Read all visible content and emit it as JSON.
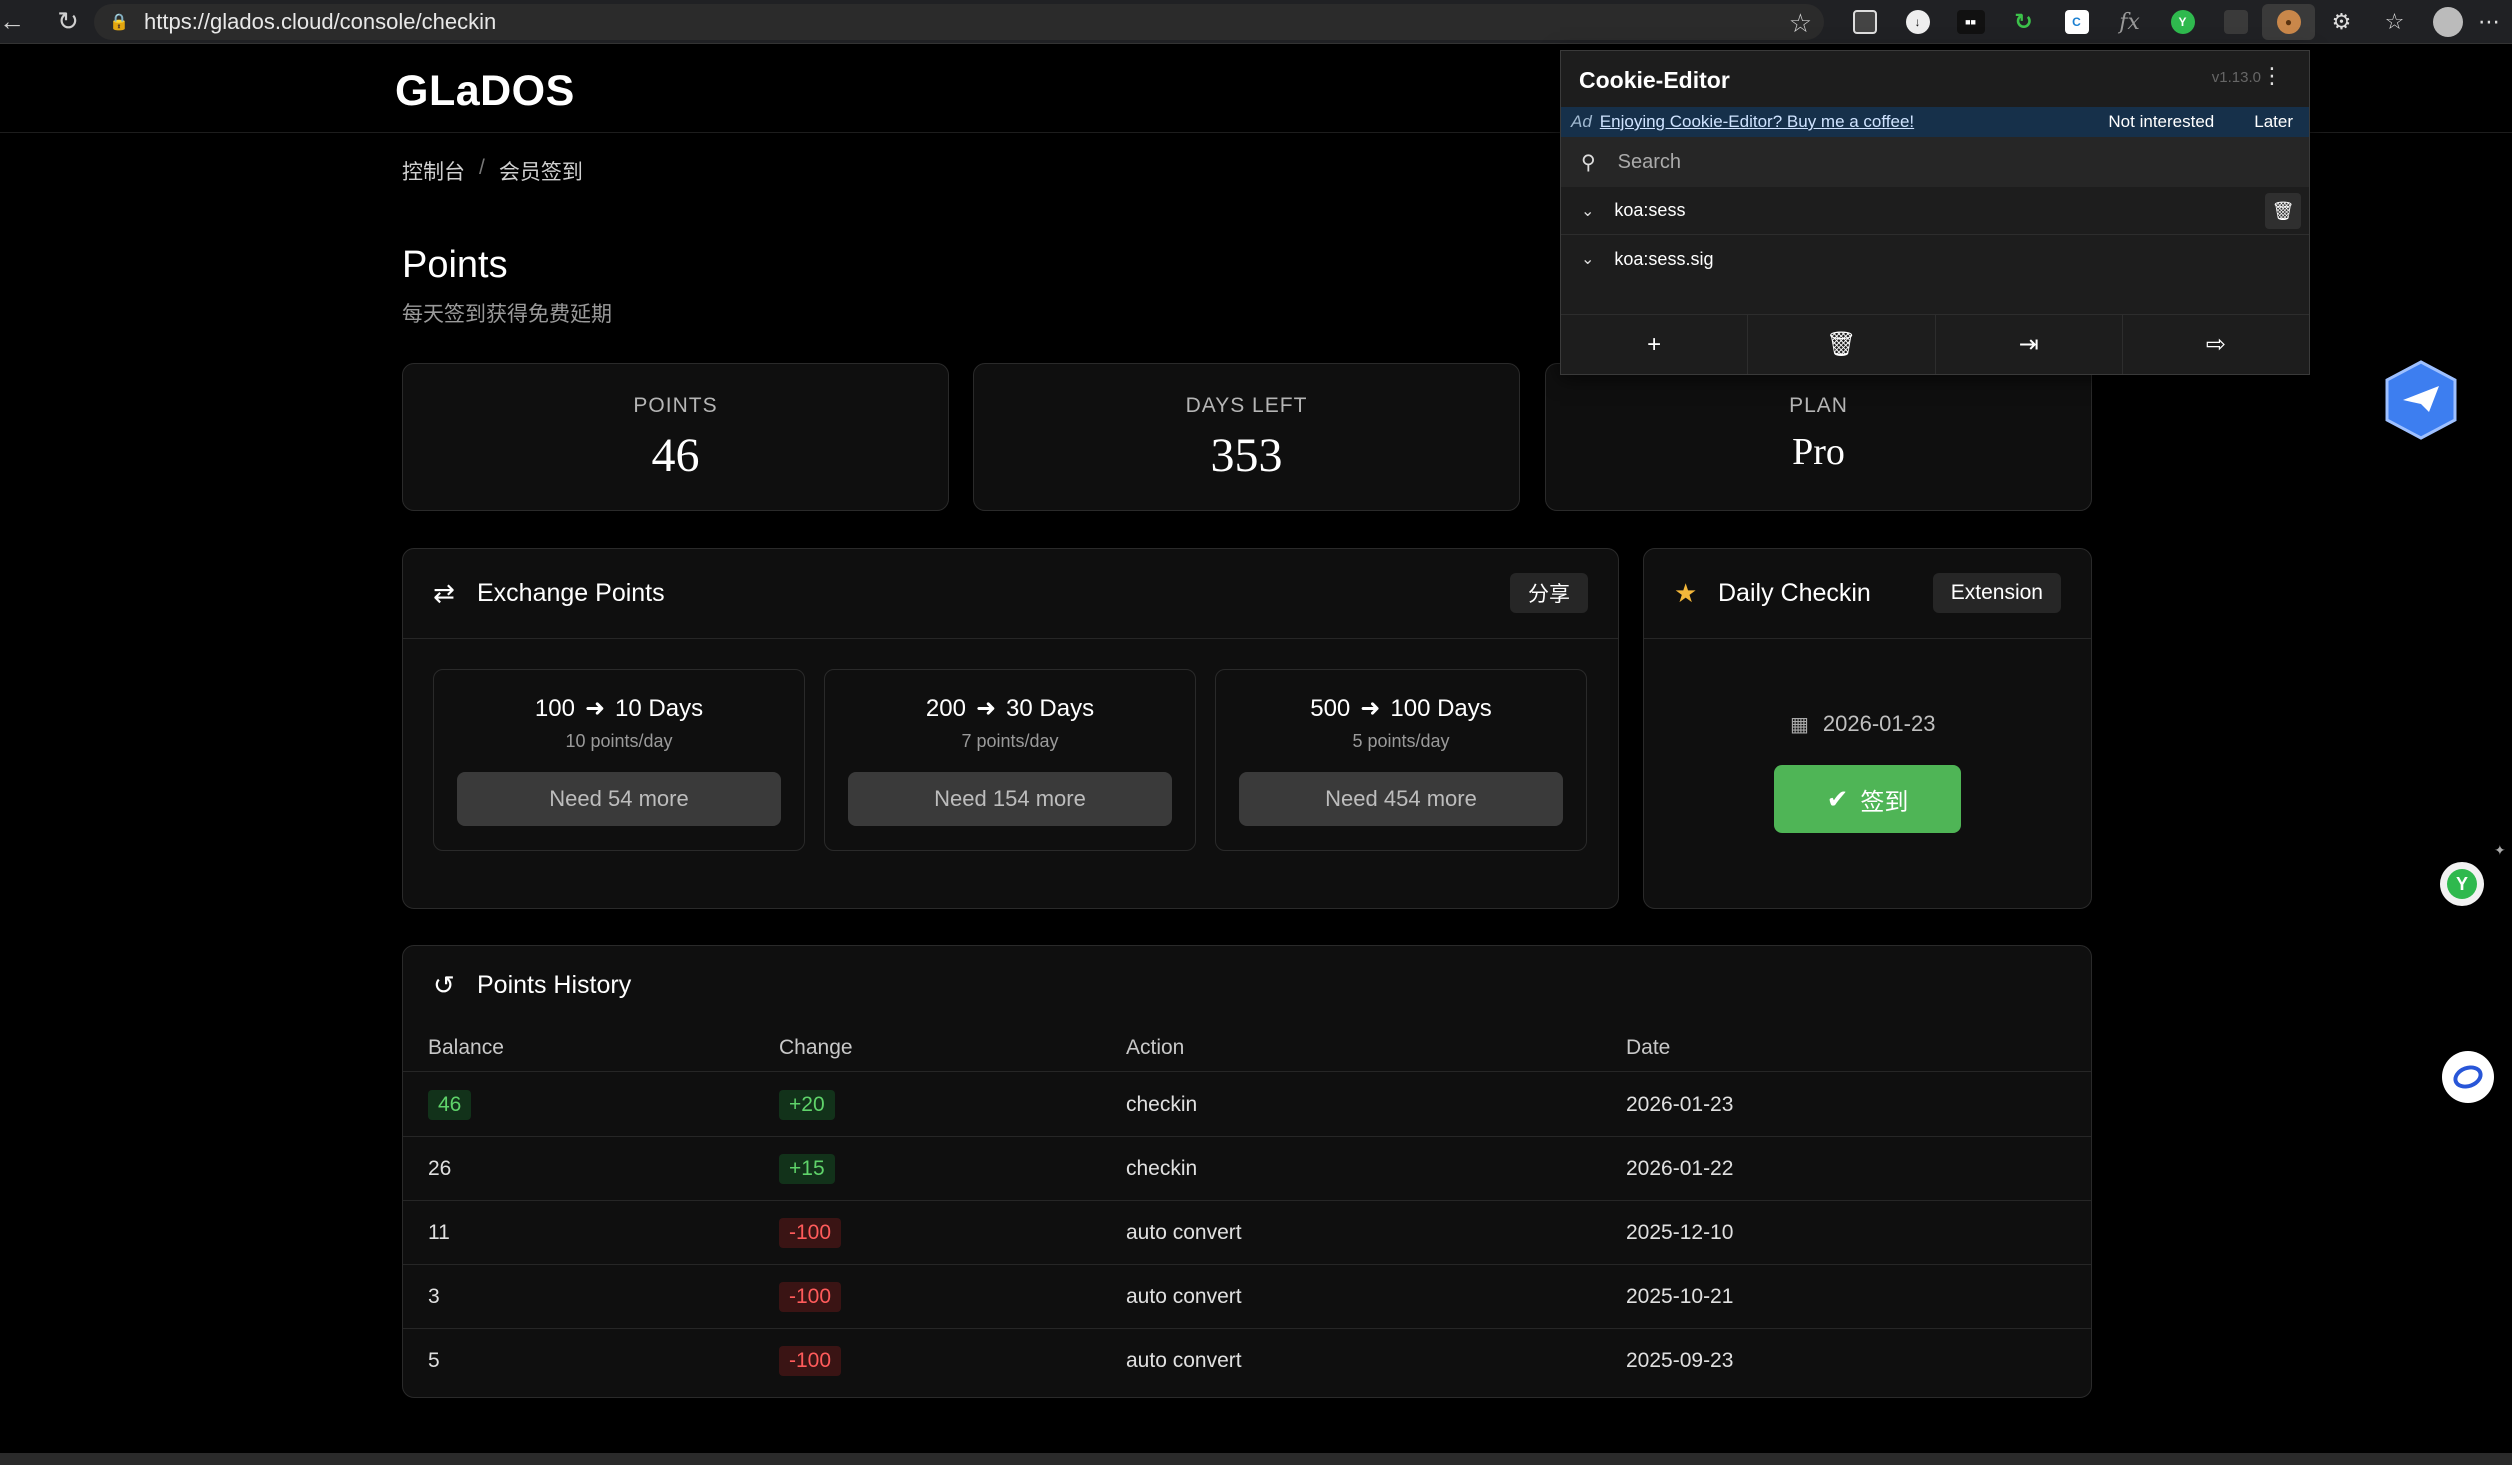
{
  "browser": {
    "url": "https://glados.cloud/console/checkin"
  },
  "site": {
    "logo": "GLaDOS",
    "breadcrumb": [
      "控制台",
      "会员签到"
    ],
    "breadcrumb_sep": "/",
    "title": "Points",
    "subtitle": "每天签到获得免费延期"
  },
  "stats": [
    {
      "label": "POINTS",
      "value": "46"
    },
    {
      "label": "DAYS LEFT",
      "value": "353"
    },
    {
      "label": "PLAN",
      "value": "Pro"
    }
  ],
  "exchange": {
    "title": "Exchange Points",
    "share_label": "分享",
    "options": [
      {
        "points": "100",
        "days": "10 Days",
        "rate": "10 points/day",
        "button": "Need 54 more"
      },
      {
        "points": "200",
        "days": "30 Days",
        "rate": "7 points/day",
        "button": "Need 154 more"
      },
      {
        "points": "500",
        "days": "100 Days",
        "rate": "5 points/day",
        "button": "Need 454 more"
      }
    ]
  },
  "checkin": {
    "title": "Daily Checkin",
    "extension_label": "Extension",
    "date": "2026-01-23",
    "button": "签到"
  },
  "history": {
    "title": "Points History",
    "columns": [
      "Balance",
      "Change",
      "Action",
      "Date"
    ],
    "rows": [
      {
        "balance": "46",
        "change": "+20",
        "action": "checkin",
        "date": "2026-01-23"
      },
      {
        "balance": "26",
        "change": "+15",
        "action": "checkin",
        "date": "2026-01-22"
      },
      {
        "balance": "11",
        "change": "-100",
        "action": "auto convert",
        "date": "2025-12-10"
      },
      {
        "balance": "3",
        "change": "-100",
        "action": "auto convert",
        "date": "2025-10-21"
      },
      {
        "balance": "5",
        "change": "-100",
        "action": "auto convert",
        "date": "2025-09-23"
      }
    ]
  },
  "cookie_editor": {
    "title": "Cookie-Editor",
    "version": "v1.13.0",
    "ad_tag": "Ad",
    "ad_text": "Enjoying Cookie-Editor? Buy me a coffee!",
    "not_interested": "Not interested",
    "later": "Later",
    "search_placeholder": "Search",
    "cookies": [
      "koa:sess",
      "koa:sess.sig"
    ]
  },
  "colors": {
    "accent_green": "#4fb556",
    "positive": "#5fd36a",
    "negative": "#ff5b5b",
    "ad_bar": "#16304a"
  }
}
